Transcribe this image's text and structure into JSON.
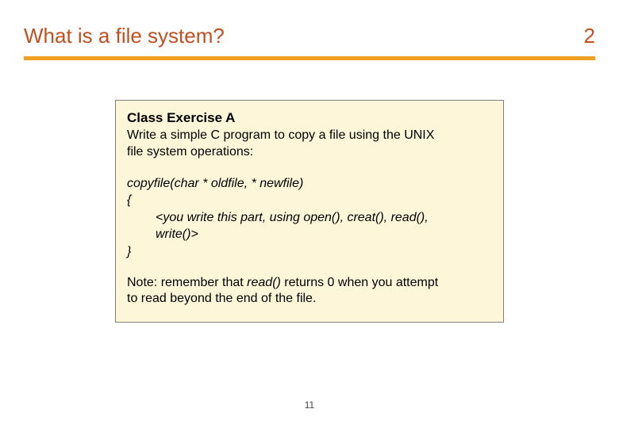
{
  "header": {
    "title": "What is a file system?",
    "page_number": "2"
  },
  "exercise": {
    "heading": "Class Exercise A",
    "intro_line1": "Write a simple C program to copy a file using the UNIX",
    "intro_line2": "file system operations:",
    "code": {
      "sig": "copyfile(char * oldfile, * newfile)",
      "open": "{",
      "body_l1": "<you write this part, using open(), creat(),  read(),",
      "body_l2": "write()>",
      "close": "}"
    },
    "note_prefix": "Note: remember that ",
    "note_em": "read()",
    "note_mid": " returns 0 when you attempt",
    "note_line2": "to read beyond the end of the file."
  },
  "footer": {
    "slide_no": "11"
  }
}
